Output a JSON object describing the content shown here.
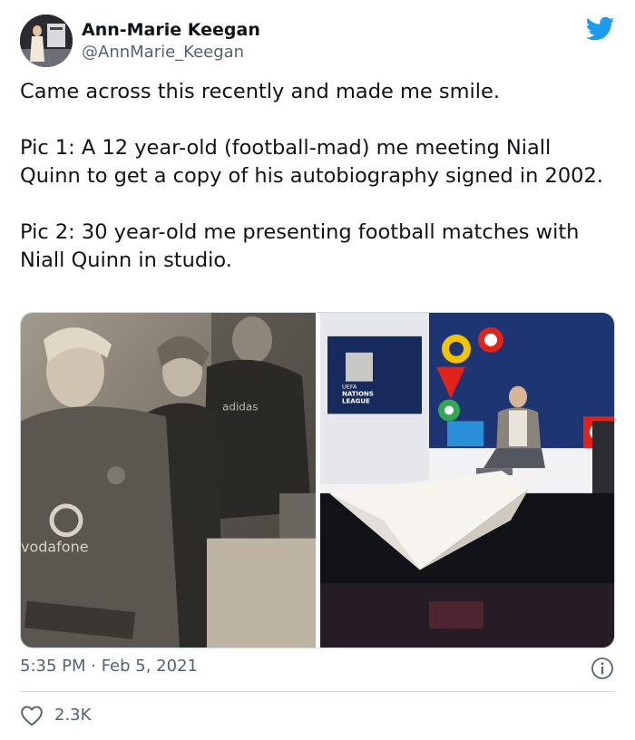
{
  "author": {
    "name": "Ann-Marie Keegan",
    "handle": "@AnnMarie_Keegan"
  },
  "brand_icon": "twitter-bird-icon",
  "tweet": {
    "paragraphs": [
      "Came across this recently and made me smile.",
      "Pic 1: A 12 year-old (football-mad) me meeting Niall Quinn to get a copy of his autobiography signed in 2002.",
      "Pic 2: 30 year-old me presenting football matches with Niall Quinn in studio."
    ]
  },
  "media": {
    "pic1": {
      "jersey_sponsor": "vodafone",
      "bg_text": "adidas"
    },
    "pic2": {
      "logo_text_1": "UEFA",
      "logo_text_2": "NATIONS",
      "logo_text_3": "LEAGUE"
    }
  },
  "meta": {
    "timestamp": "5:35 PM · Feb 5, 2021"
  },
  "engagement": {
    "likes": "2.3K"
  },
  "colors": {
    "twitter_blue": "#1d9bf0",
    "secondary_text": "#536471",
    "border": "#cfd9de"
  }
}
